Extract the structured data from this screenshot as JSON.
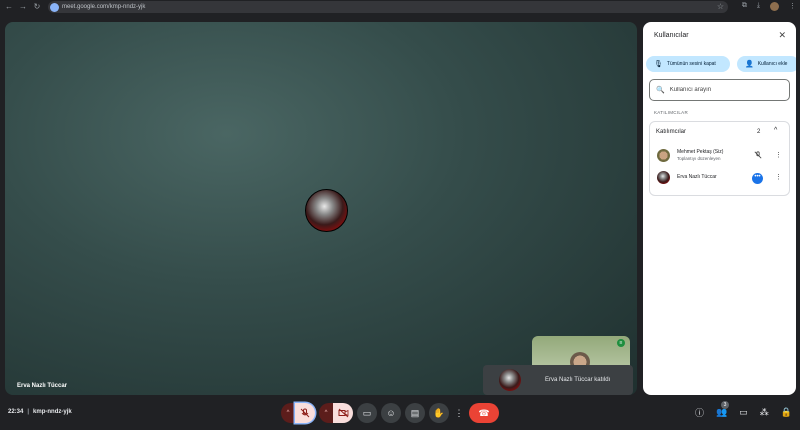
{
  "browser": {
    "url": "meet.google.com/kmp-nndz-yjk"
  },
  "stage": {
    "speaker_name": "Erva Nazlı Tüccar"
  },
  "toast": {
    "text": "Erva Nazlı Tüccar katıldı"
  },
  "meeting": {
    "time": "22:34",
    "separator": "|",
    "code": "kmp-nndz-yjk"
  },
  "controls": {
    "people_count": "3"
  },
  "people_panel": {
    "title": "Kullanıcılar",
    "mute_all_label": "Tümünün sesini kapat",
    "add_people_label": "Kullanıcı ekle",
    "search_placeholder": "Kullanıcı arayın",
    "section_label": "KATILIMCILAR",
    "group_label": "Katılımcılar",
    "group_count": "2",
    "participants": [
      {
        "name": "Mehmet Pektaş (Siz)",
        "subtitle": "Toplantıyı düzenleyen"
      },
      {
        "name": "Erva Nazlı Tüccar",
        "subtitle": ""
      }
    ]
  },
  "colors": {
    "accent": "#1a73e8",
    "end_call": "#ea4335",
    "chip": "#c2e7ff"
  }
}
